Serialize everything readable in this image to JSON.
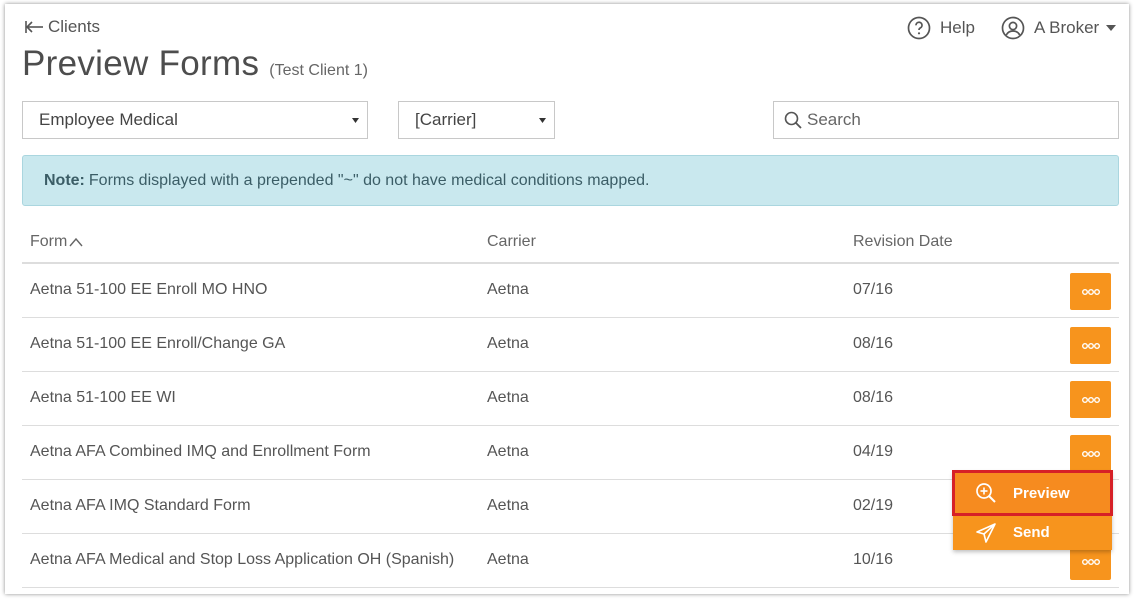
{
  "nav": {
    "back_label": "Clients",
    "help_label": "Help",
    "user_label": "A Broker"
  },
  "header": {
    "title": "Preview Forms",
    "client": "(Test Client 1)"
  },
  "filters": {
    "plan_select": "Employee Medical",
    "carrier_select": "[Carrier]",
    "search_placeholder": "Search"
  },
  "note": {
    "label": "Note:",
    "text": "Forms displayed with a prepended \"~\" do not have medical conditions mapped."
  },
  "table": {
    "columns": [
      "Form",
      "Carrier",
      "Revision Date"
    ],
    "rows": [
      {
        "form": "Aetna 51-100 EE Enroll MO HNO",
        "carrier": "Aetna",
        "revision": "07/16"
      },
      {
        "form": "Aetna 51-100 EE Enroll/Change GA",
        "carrier": "Aetna",
        "revision": "08/16"
      },
      {
        "form": "Aetna 51-100 EE WI",
        "carrier": "Aetna",
        "revision": "08/16"
      },
      {
        "form": "Aetna AFA Combined IMQ and Enrollment Form",
        "carrier": "Aetna",
        "revision": "04/19"
      },
      {
        "form": "Aetna AFA IMQ Standard Form",
        "carrier": "Aetna",
        "revision": "02/19"
      },
      {
        "form": "Aetna AFA Medical and Stop Loss Application OH (Spanish)",
        "carrier": "Aetna",
        "revision": "10/16"
      }
    ]
  },
  "row_menu": {
    "items": [
      "Preview",
      "Send"
    ]
  },
  "colors": {
    "accent": "#f7941d",
    "note_bg": "#c9e8ee",
    "highlight": "#d62027"
  },
  "icons": {
    "back": "arrow-left-icon",
    "help": "question-circle-icon",
    "user": "user-circle-icon",
    "search": "search-icon",
    "more": "ellipsis-icon",
    "preview": "zoom-in-icon",
    "send": "paper-plane-icon"
  }
}
